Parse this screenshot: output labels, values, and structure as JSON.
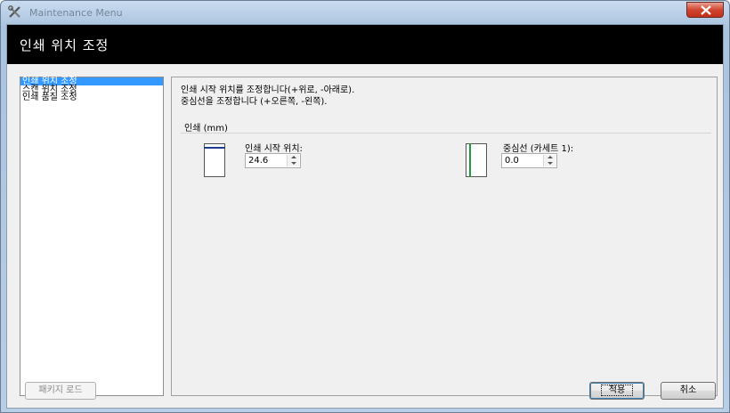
{
  "window": {
    "title": "Maintenance Menu",
    "close_icon": "close-icon"
  },
  "header": {
    "title": "인쇄 위치 조정"
  },
  "nav": {
    "items": [
      {
        "label": "인쇄 위치 조정",
        "selected": true
      },
      {
        "label": "스캔 위치 조정",
        "selected": false
      },
      {
        "label": "인쇄 품질 조정",
        "selected": false
      }
    ]
  },
  "panel": {
    "desc_line1": "인쇄 시작 위치를 조정합니다(+위로, -아래로).",
    "desc_line2": "중심선을 조정합니다 (+오른쪽, -왼쪽).",
    "group_title": "인쇄 (mm)",
    "start_label": "인쇄 시작 위치:",
    "start_value": "24.6",
    "center_label": "중심선 (카세트 1):",
    "center_value": "0.0"
  },
  "buttons": {
    "package_load": "패키지 로드",
    "apply": "적용",
    "cancel": "취소"
  },
  "colors": {
    "selection": "#3399ff",
    "start_marker": "#1f3c8f",
    "center_marker": "#1e9a3a",
    "close_button": "#c9402a"
  }
}
